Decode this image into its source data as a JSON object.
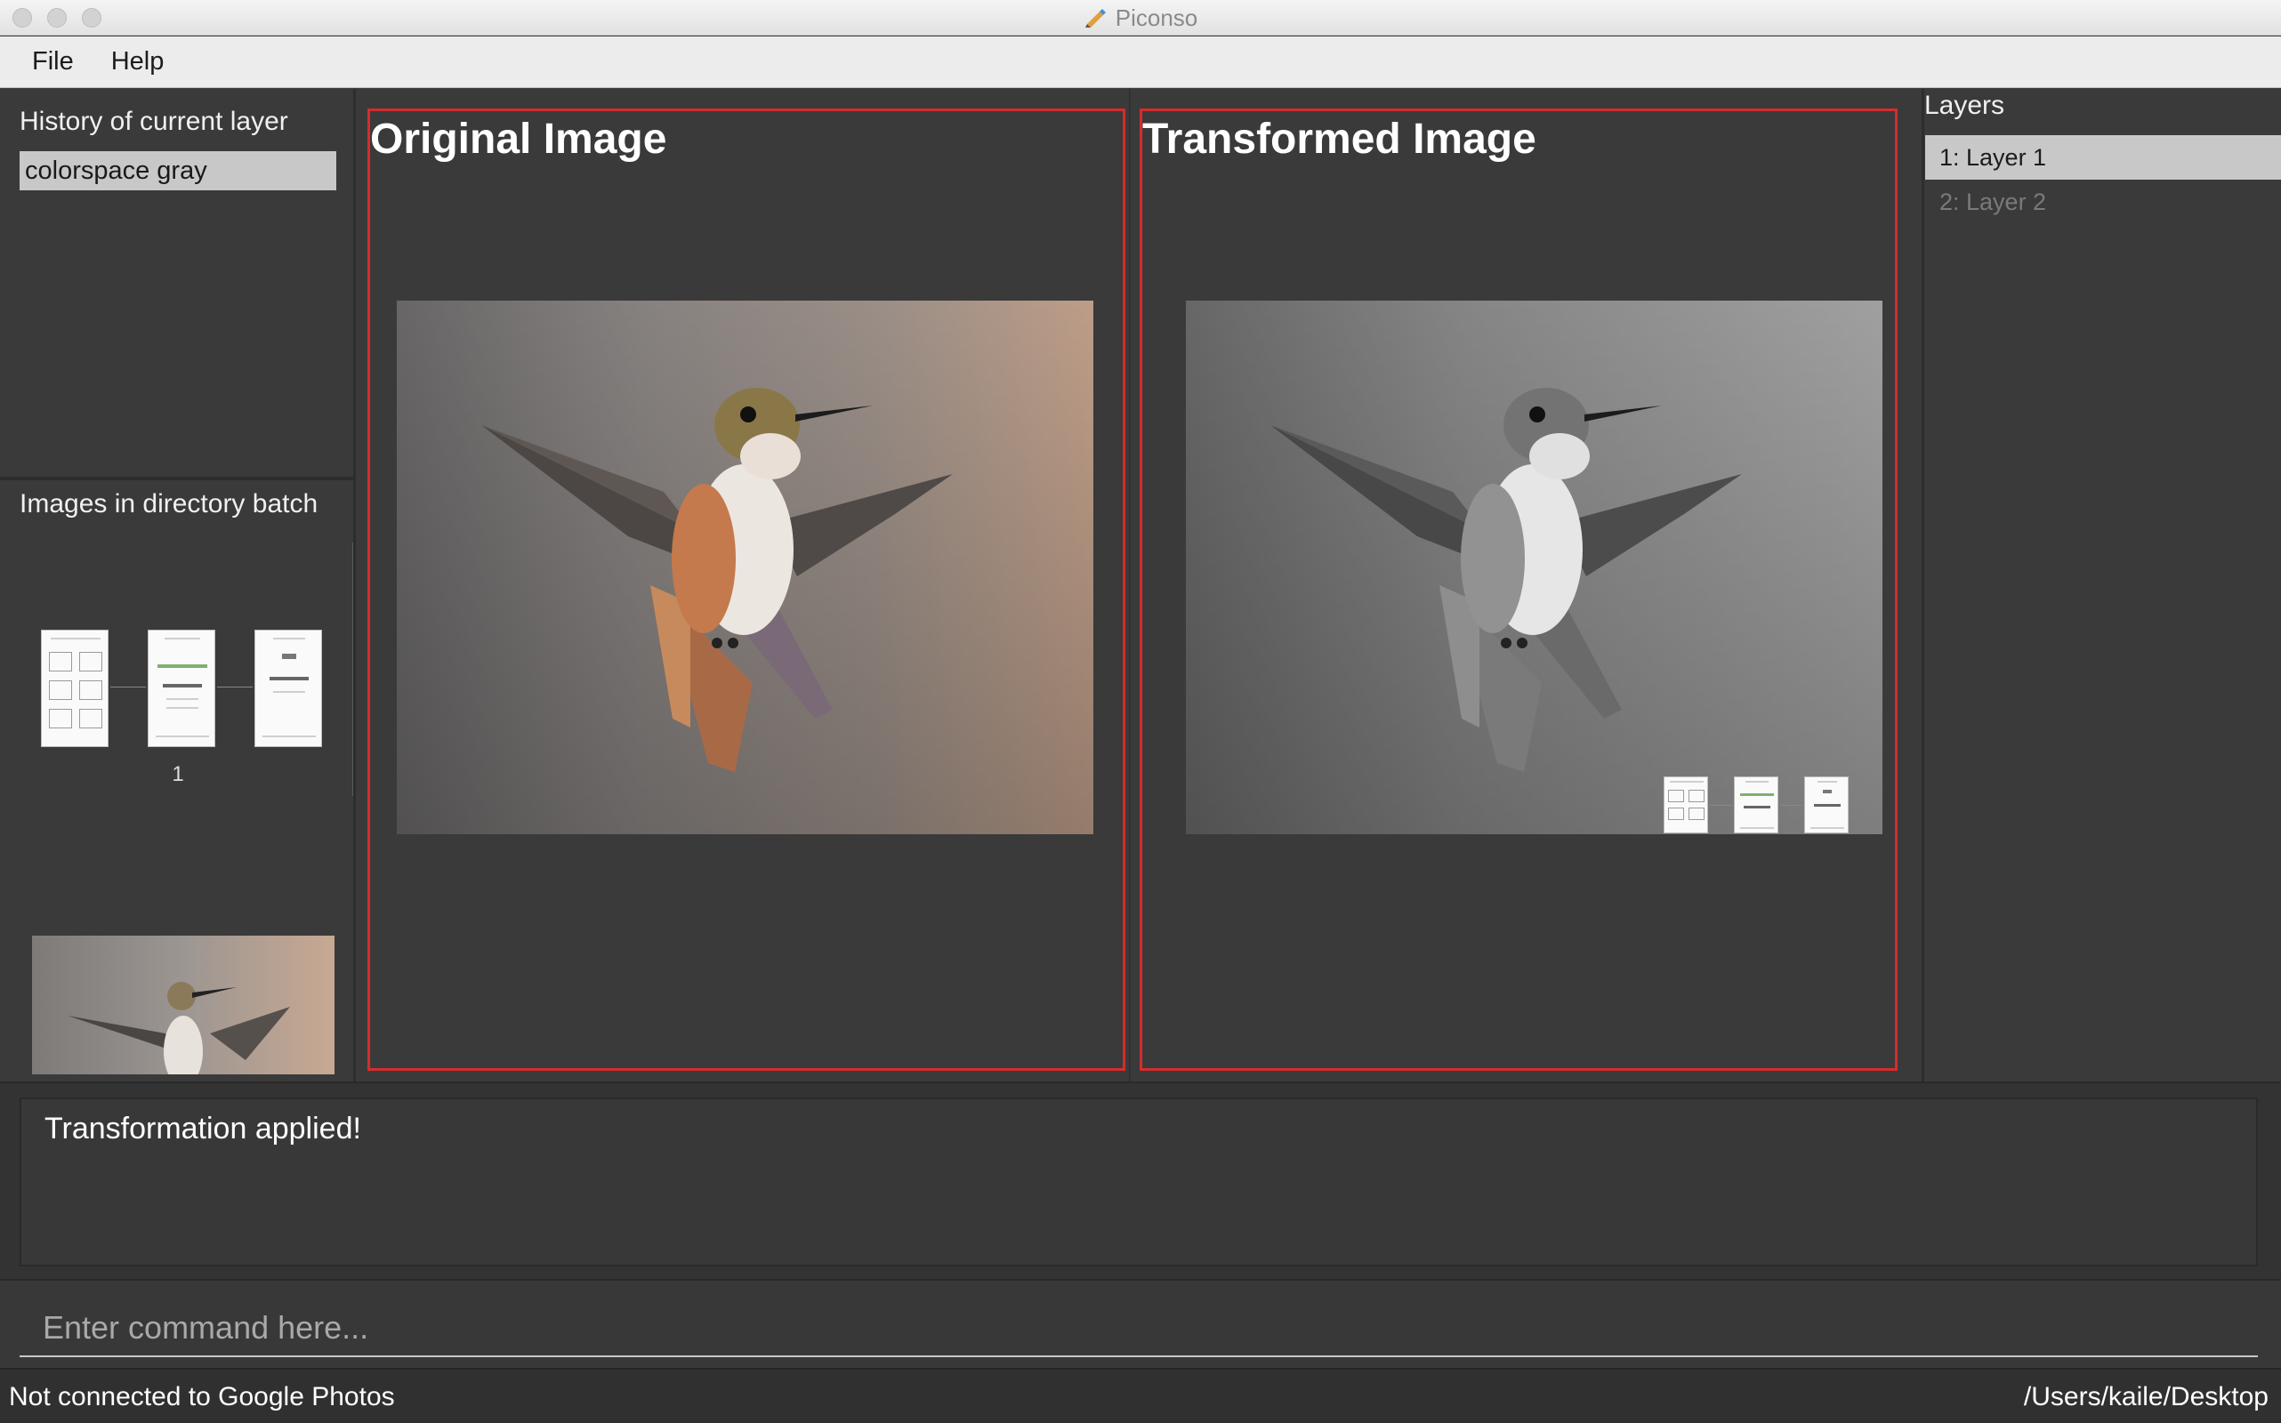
{
  "window": {
    "title": "Piconso"
  },
  "menu": {
    "items": [
      "File",
      "Help"
    ]
  },
  "history": {
    "title": "History of current layer",
    "items": [
      "colorspace gray"
    ]
  },
  "batch": {
    "title": "Images in directory batch",
    "index_label": "1"
  },
  "original": {
    "title": "Original Image"
  },
  "transformed": {
    "title": "Transformed Image"
  },
  "layers": {
    "title": "Layers",
    "items": [
      "1: Layer 1",
      "2: Layer 2"
    ]
  },
  "console": {
    "message": "Transformation applied!"
  },
  "command": {
    "placeholder": "Enter command here..."
  },
  "status": {
    "connection": "Not connected to Google Photos",
    "path": "/Users/kaile/Desktop"
  },
  "colors": {
    "background": "#3a3a3a",
    "panel_border": "#d62c2c",
    "selection": "#c8c8c8"
  }
}
